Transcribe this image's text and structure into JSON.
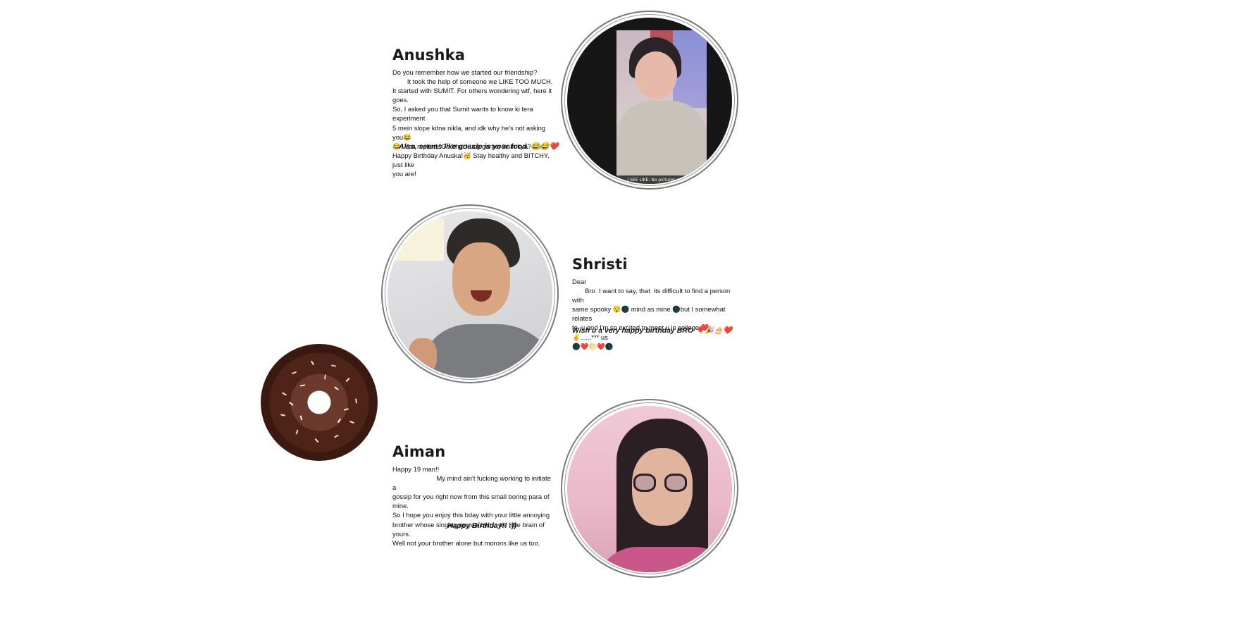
{
  "sections": [
    {
      "name": "Anushka",
      "message_lines": [
        "Do you remember how we started our friendship?",
        "        It took the help of someone we LIKE TOO MUCH.",
        "It started with SUMIT. For others wondering wtf, here it goes.",
        "So, I asked you that Sumit wants to know ki tera experiment",
        "5 mein slope kitna nikla, and idk why he's not asking you😂",
        "😂. You replied,\"Oh bhai kuch garbar hain kya? 😂😂\"",
        "Happy Birthday Anuska!🥳 Stay healthy and BITCHY, just like",
        "you are!"
      ],
      "closing": "Also, seems like gossip is your food. 😂😂❤️",
      "photo_caption": "I SEE LIKE: No pictures mayn. 😏"
    },
    {
      "name": "Shristi",
      "message_lines": [
        "Dear",
        "       Bro  I want to say, that  its difficult to find a person with",
        "same spooky 😯🌑 mind as mine 🌑but I somewhat relates",
        "to  u and I'm so excited to meet u in college ❤️✌️......*** us",
        "🌑❤️🌕❤️🌑"
      ],
      "closing": "Wish u a very happy birthday BRO 🎈🎉🎂❤️"
    },
    {
      "name": "Aiman",
      "message_lines": [
        "Happy 19 man!!",
        "                        My mind ain't fucking working to initiate a",
        "gossip for you right now from this small boring para of mine.",
        "So I hope you enjoy this bday with your little annoying",
        "brother whose singing rings a bell in tht little brain of yours.",
        "Well not your brother alone but morons like us too."
      ],
      "closing": "Happy Birthday!! :))"
    }
  ],
  "colors": {
    "text": "#111111",
    "frame": "#7a7a7a",
    "background": "#ffffff"
  },
  "icons": {
    "donut": "chocolate-donut-icon"
  }
}
